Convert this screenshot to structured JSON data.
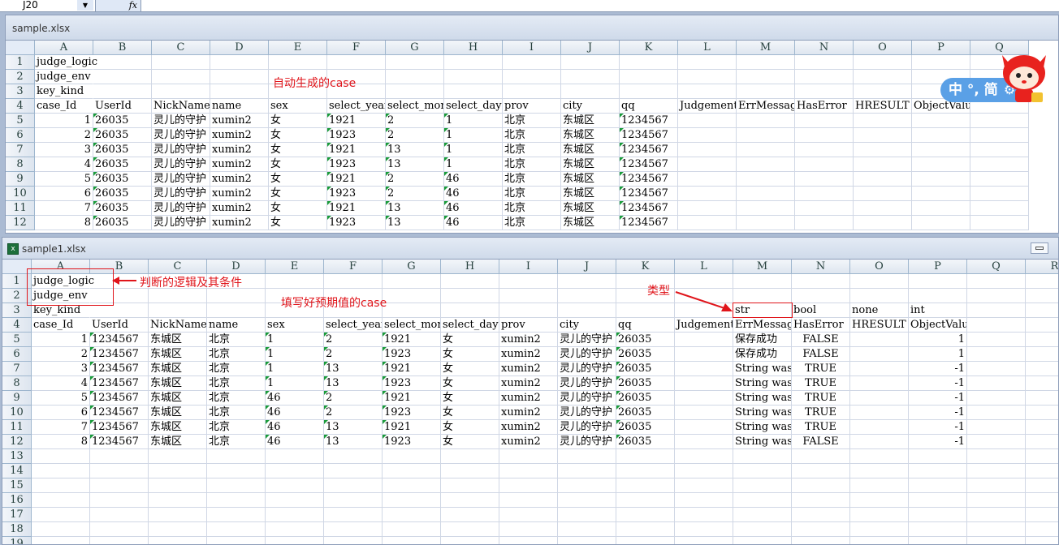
{
  "formula_bar": {
    "cell_ref": "J20",
    "fx_label": "fx"
  },
  "ime": {
    "text": "中 °, 简"
  },
  "window1": {
    "title": "sample.xlsx",
    "columns": [
      "A",
      "B",
      "C",
      "D",
      "E",
      "F",
      "G",
      "H",
      "I",
      "J",
      "K",
      "L",
      "M",
      "N",
      "O",
      "P",
      "Q"
    ],
    "rows": [
      {
        "n": "1",
        "cells": [
          "judge_logic",
          "",
          "",
          "",
          "",
          "",
          "",
          "",
          "",
          "",
          "",
          "",
          "",
          "",
          "",
          "",
          ""
        ]
      },
      {
        "n": "2",
        "cells": [
          "judge_env",
          "",
          "",
          "",
          "",
          "",
          "",
          "",
          "",
          "",
          "",
          "",
          "",
          "",
          "",
          "",
          ""
        ]
      },
      {
        "n": "3",
        "cells": [
          "key_kind",
          "",
          "",
          "",
          "",
          "",
          "",
          "",
          "",
          "",
          "",
          "",
          "",
          "",
          "",
          "",
          ""
        ]
      },
      {
        "n": "4",
        "cells": [
          "case_Id",
          "UserId",
          "NickName",
          "name",
          "sex",
          "select_year",
          "select_month",
          "select_day",
          "prov",
          "city",
          "qq",
          "Judgement",
          "ErrMessage",
          "HasError",
          "HRESULT",
          "ObjectValue",
          ""
        ]
      },
      {
        "n": "5",
        "cells": [
          "1",
          "26035",
          "灵儿的守护",
          "xumin2",
          "女",
          "1921",
          "2",
          "1",
          "北京",
          "东城区",
          "1234567",
          "",
          "",
          "",
          "",
          "",
          ""
        ]
      },
      {
        "n": "6",
        "cells": [
          "2",
          "26035",
          "灵儿的守护",
          "xumin2",
          "女",
          "1923",
          "2",
          "1",
          "北京",
          "东城区",
          "1234567",
          "",
          "",
          "",
          "",
          "",
          ""
        ]
      },
      {
        "n": "7",
        "cells": [
          "3",
          "26035",
          "灵儿的守护",
          "xumin2",
          "女",
          "1921",
          "13",
          "1",
          "北京",
          "东城区",
          "1234567",
          "",
          "",
          "",
          "",
          "",
          ""
        ]
      },
      {
        "n": "8",
        "cells": [
          "4",
          "26035",
          "灵儿的守护",
          "xumin2",
          "女",
          "1923",
          "13",
          "1",
          "北京",
          "东城区",
          "1234567",
          "",
          "",
          "",
          "",
          "",
          ""
        ]
      },
      {
        "n": "9",
        "cells": [
          "5",
          "26035",
          "灵儿的守护",
          "xumin2",
          "女",
          "1921",
          "2",
          "46",
          "北京",
          "东城区",
          "1234567",
          "",
          "",
          "",
          "",
          "",
          ""
        ]
      },
      {
        "n": "10",
        "cells": [
          "6",
          "26035",
          "灵儿的守护",
          "xumin2",
          "女",
          "1923",
          "2",
          "46",
          "北京",
          "东城区",
          "1234567",
          "",
          "",
          "",
          "",
          "",
          ""
        ]
      },
      {
        "n": "11",
        "cells": [
          "7",
          "26035",
          "灵儿的守护",
          "xumin2",
          "女",
          "1921",
          "13",
          "46",
          "北京",
          "东城区",
          "1234567",
          "",
          "",
          "",
          "",
          "",
          ""
        ]
      },
      {
        "n": "12",
        "cells": [
          "8",
          "26035",
          "灵儿的守护",
          "xumin2",
          "女",
          "1923",
          "13",
          "46",
          "北京",
          "东城区",
          "1234567",
          "",
          "",
          "",
          "",
          "",
          ""
        ]
      }
    ]
  },
  "window2": {
    "title": "sample1.xlsx",
    "columns": [
      "A",
      "B",
      "C",
      "D",
      "E",
      "F",
      "G",
      "H",
      "I",
      "J",
      "K",
      "L",
      "M",
      "N",
      "O",
      "P",
      "Q",
      "R"
    ],
    "rows": [
      {
        "n": "1",
        "cells": [
          "judge_logic",
          "",
          "",
          "",
          "",
          "",
          "",
          "",
          "",
          "",
          "",
          "",
          "",
          "",
          "",
          "",
          "",
          ""
        ]
      },
      {
        "n": "2",
        "cells": [
          "judge_env",
          "",
          "",
          "",
          "",
          "",
          "",
          "",
          "",
          "",
          "",
          "",
          "",
          "",
          "",
          "",
          "",
          ""
        ]
      },
      {
        "n": "3",
        "cells": [
          "key_kind",
          "",
          "",
          "",
          "",
          "",
          "",
          "",
          "",
          "",
          "",
          "",
          "str",
          "bool",
          "none",
          "int",
          "",
          ""
        ]
      },
      {
        "n": "4",
        "cells": [
          "case_Id",
          "UserId",
          "NickName",
          "name",
          "sex",
          "select_year",
          "select_month",
          "select_day",
          "prov",
          "city",
          "qq",
          "Judgement",
          "ErrMessage",
          "HasError",
          "HRESULT",
          "ObjectValue",
          "",
          ""
        ]
      },
      {
        "n": "5",
        "cells": [
          "1",
          "1234567",
          "东城区",
          "北京",
          "1",
          "2",
          "1921",
          "女",
          "xumin2",
          "灵儿的守护",
          "26035",
          "",
          "保存成功",
          "FALSE",
          "",
          "1",
          "",
          ""
        ]
      },
      {
        "n": "6",
        "cells": [
          "2",
          "1234567",
          "东城区",
          "北京",
          "1",
          "2",
          "1923",
          "女",
          "xumin2",
          "灵儿的守护",
          "26035",
          "",
          "保存成功",
          "FALSE",
          "",
          "1",
          "",
          ""
        ]
      },
      {
        "n": "7",
        "cells": [
          "3",
          "1234567",
          "东城区",
          "北京",
          "1",
          "13",
          "1921",
          "女",
          "xumin2",
          "灵儿的守护",
          "26035",
          "",
          "String was",
          "TRUE",
          "",
          "-1",
          "",
          ""
        ]
      },
      {
        "n": "8",
        "cells": [
          "4",
          "1234567",
          "东城区",
          "北京",
          "1",
          "13",
          "1923",
          "女",
          "xumin2",
          "灵儿的守护",
          "26035",
          "",
          "String was",
          "TRUE",
          "",
          "-1",
          "",
          ""
        ]
      },
      {
        "n": "9",
        "cells": [
          "5",
          "1234567",
          "东城区",
          "北京",
          "46",
          "2",
          "1921",
          "女",
          "xumin2",
          "灵儿的守护",
          "26035",
          "",
          "String was",
          "TRUE",
          "",
          "-1",
          "",
          ""
        ]
      },
      {
        "n": "10",
        "cells": [
          "6",
          "1234567",
          "东城区",
          "北京",
          "46",
          "2",
          "1923",
          "女",
          "xumin2",
          "灵儿的守护",
          "26035",
          "",
          "String was",
          "TRUE",
          "",
          "-1",
          "",
          ""
        ]
      },
      {
        "n": "11",
        "cells": [
          "7",
          "1234567",
          "东城区",
          "北京",
          "46",
          "13",
          "1921",
          "女",
          "xumin2",
          "灵儿的守护",
          "26035",
          "",
          "String was",
          "TRUE",
          "",
          "-1",
          "",
          ""
        ]
      },
      {
        "n": "12",
        "cells": [
          "8",
          "1234567",
          "东城区",
          "北京",
          "46",
          "13",
          "1923",
          "女",
          "xumin2",
          "灵儿的守护",
          "26035",
          "",
          "String was",
          "FALSE",
          "",
          "-1",
          "",
          ""
        ]
      },
      {
        "n": "13",
        "cells": []
      },
      {
        "n": "14",
        "cells": []
      },
      {
        "n": "15",
        "cells": []
      },
      {
        "n": "16",
        "cells": []
      },
      {
        "n": "17",
        "cells": []
      },
      {
        "n": "18",
        "cells": []
      },
      {
        "n": "19",
        "cells": []
      }
    ]
  },
  "annotations": {
    "auto_case": "自动生成的case",
    "judge_note": "判断的逻辑及其条件",
    "filled_case": "填写好预期值的case",
    "type_label": "类型"
  },
  "colors": {
    "annotation_red": "#e0151b",
    "triangle_green": "#1a9b3a",
    "ime_blue": "#5aa0e6"
  }
}
